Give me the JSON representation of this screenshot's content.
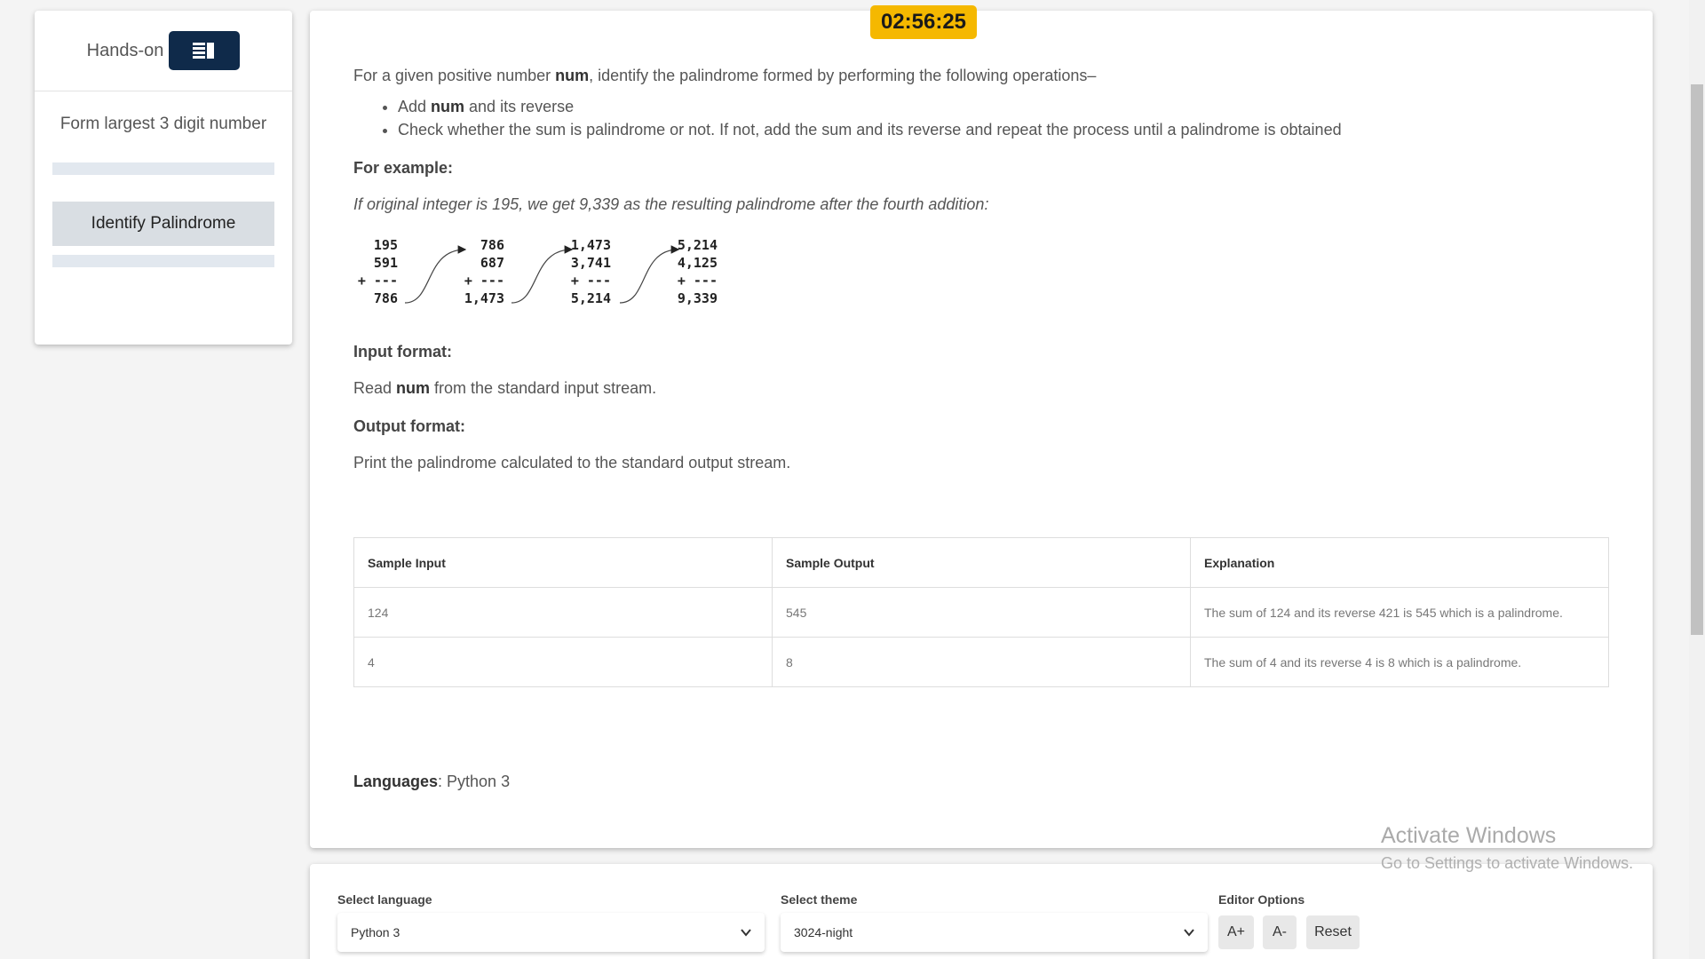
{
  "sidebar": {
    "hands_on_label": "Hands-on",
    "questions": [
      "Form largest 3 digit number",
      "Identify Palindrome"
    ],
    "active_question": "Identify Palindrome"
  },
  "timer": "02:56:25",
  "problem": {
    "intro_pre": "For a given positive number ",
    "intro_bold": "num",
    "intro_post": ", identify the palindrome formed by performing the following operations–",
    "op1_pre": "Add ",
    "op1_bold": "num",
    "op1_post": " and its reverse",
    "op2": "Check whether the sum is palindrome or not. If not, add the sum and its reverse and repeat the process until a palindrome is obtained",
    "example_heading": "For example:",
    "example_text": "If original integer is 195, we get 9,339 as the resulting palindrome after the fourth addition:",
    "diagram": {
      "steps": [
        {
          "a": "195",
          "b": "591",
          "plus": "+ ---",
          "sum": "786"
        },
        {
          "a": "786",
          "b": "687",
          "plus": "+ ---",
          "sum": "1,473"
        },
        {
          "a": "1,473",
          "b": "3,741",
          "plus": "+ ---",
          "sum": "5,214"
        },
        {
          "a": "5,214",
          "b": "4,125",
          "plus": "+ ---",
          "sum": "9,339"
        }
      ]
    },
    "input_heading": "Input format:",
    "input_pre": "Read ",
    "input_bold": "num",
    "input_post": " from the standard input stream.",
    "output_heading": "Output format:",
    "output_text": "Print the palindrome calculated to the standard output stream."
  },
  "samples": {
    "headers": [
      "Sample Input",
      "Sample Output",
      "Explanation"
    ],
    "rows": [
      [
        "124",
        "545",
        "The sum of 124 and its reverse 421 is 545 which is a palindrome."
      ],
      [
        "4",
        "8",
        "The sum of 4 and its reverse 4 is 8 which is a palindrome."
      ]
    ]
  },
  "languages": {
    "label": "Languages",
    "value": ": Python 3"
  },
  "editor": {
    "language_label": "Select language",
    "language_value": "Python 3",
    "theme_label": "Select theme",
    "theme_value": "3024-night",
    "options_label": "Editor Options",
    "btn_increase": "A+",
    "btn_decrease": "A-",
    "btn_reset": "Reset"
  },
  "watermark": {
    "title": "Activate Windows",
    "subtitle": "Go to Settings to activate Windows."
  },
  "colors": {
    "accent": "#0f2a4a",
    "timer": "#f5b800"
  }
}
